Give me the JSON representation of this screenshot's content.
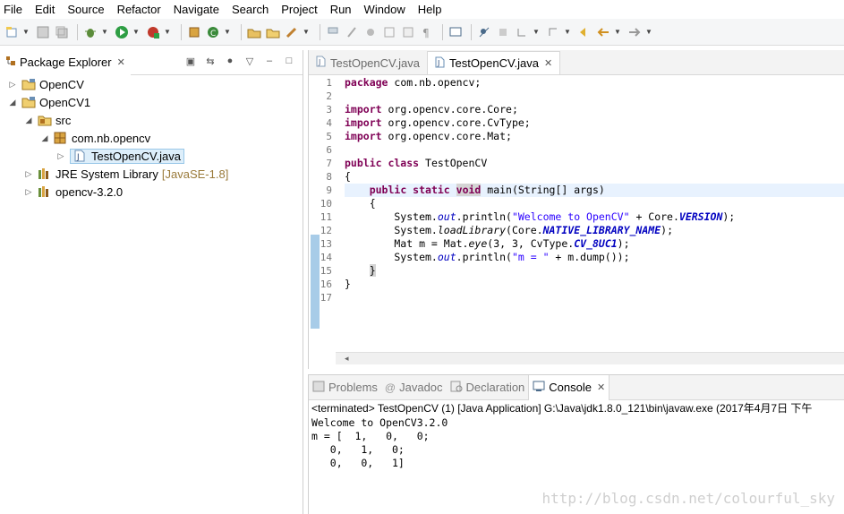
{
  "menu": [
    "File",
    "Edit",
    "Source",
    "Refactor",
    "Navigate",
    "Search",
    "Project",
    "Run",
    "Window",
    "Help"
  ],
  "package_explorer": {
    "title": "Package Explorer",
    "tree": [
      {
        "label": "OpenCV",
        "icon": "project-folder-icon"
      },
      {
        "label": "OpenCV1",
        "icon": "project-folder-icon"
      },
      {
        "label": "src",
        "icon": "source-folder-icon"
      },
      {
        "label": "com.nb.opencv",
        "icon": "package-icon"
      },
      {
        "label": "TestOpenCV.java",
        "icon": "java-file-icon"
      },
      {
        "label": "JRE System Library",
        "decoration": "[JavaSE-1.8]",
        "icon": "library-icon"
      },
      {
        "label": "opencv-3.2.0",
        "icon": "library-icon"
      }
    ]
  },
  "editor": {
    "tabs": [
      "TestOpenCV.java",
      "TestOpenCV.java"
    ],
    "line_numbers": [
      "1",
      "2",
      "3",
      "4",
      "5",
      "6",
      "7",
      "8",
      "9",
      "10",
      "11",
      "12",
      "13",
      "14",
      "15",
      "16",
      "17"
    ]
  },
  "bottom_panel": {
    "tabs": [
      "Problems",
      "Javadoc",
      "Declaration",
      "Console"
    ],
    "console_header": "<terminated> TestOpenCV (1) [Java Application] G:\\Java\\jdk1.8.0_121\\bin\\javaw.exe (2017年4月7日 下午",
    "console_output": "Welcome to OpenCV3.2.0\nm = [  1,   0,   0;\n   0,   1,   0;\n   0,   0,   1]"
  },
  "watermark": "http://blog.csdn.net/colourful_sky",
  "colors": {
    "keyword": "#7f0055",
    "string": "#2a00ff",
    "field": "#0000c0",
    "selection": "#ddeefa",
    "change_bar": "#a8cce8"
  }
}
